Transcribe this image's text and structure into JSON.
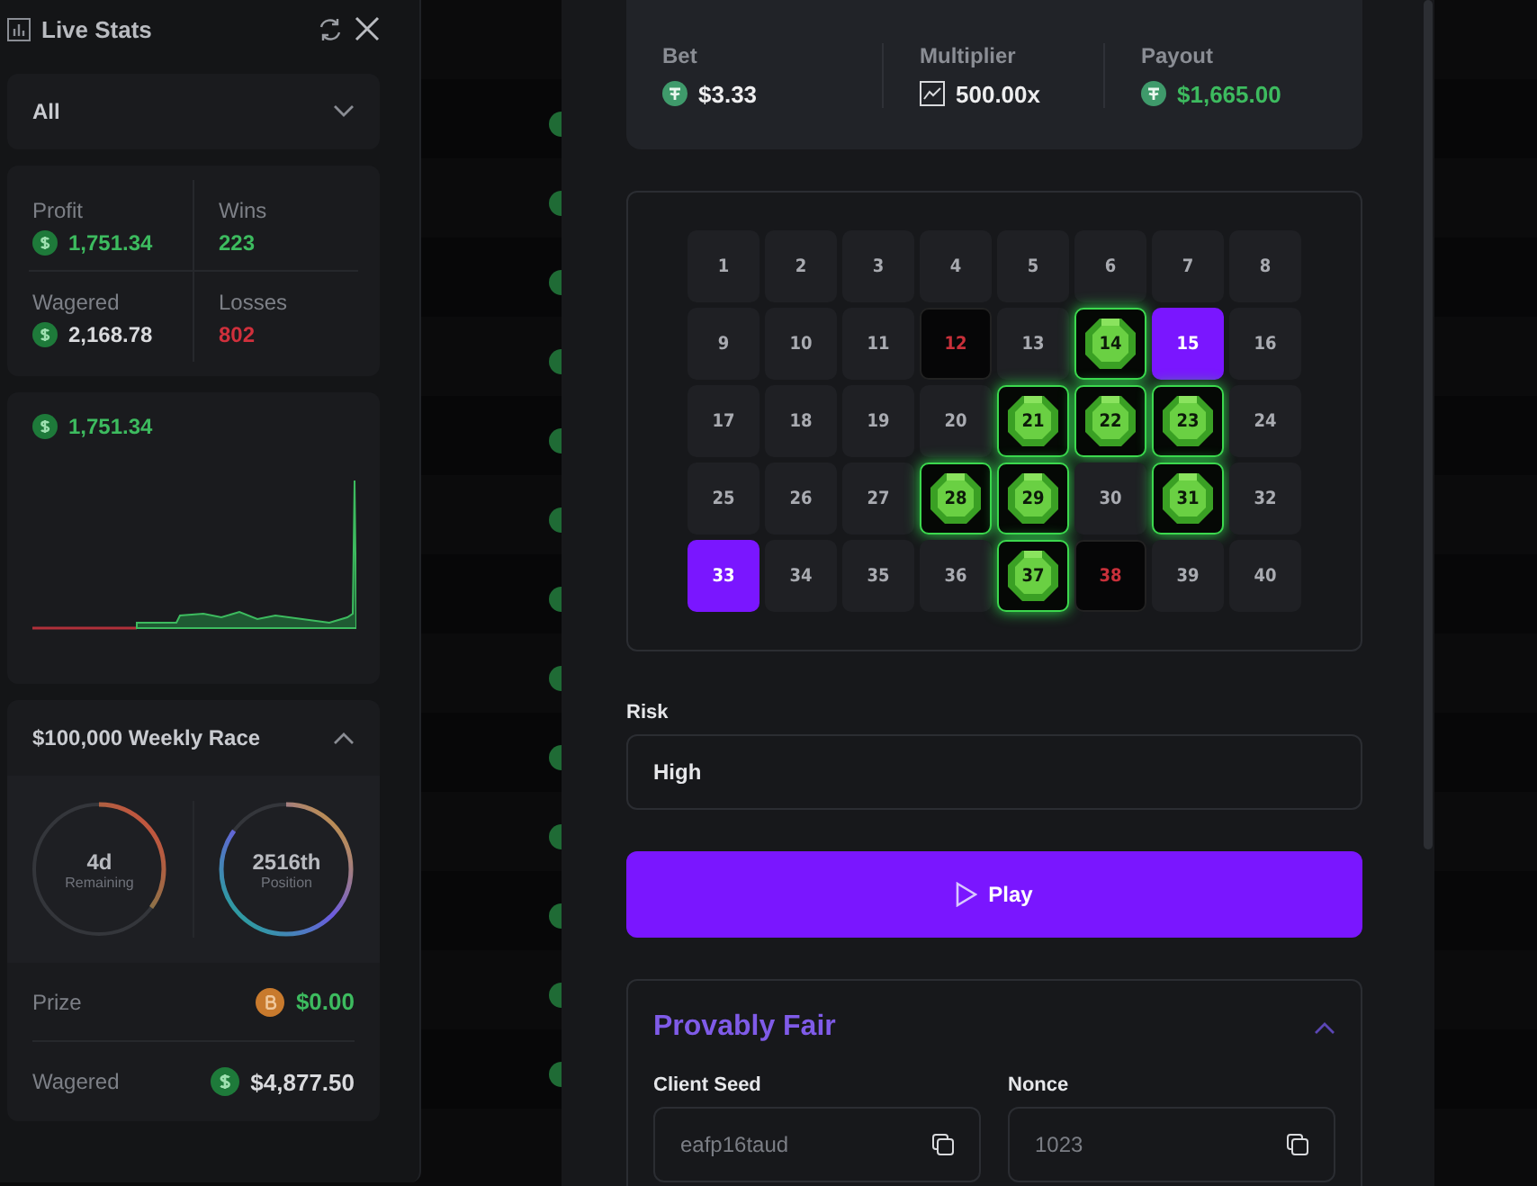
{
  "sidebar": {
    "title": "Live Stats",
    "filter": {
      "value": "All"
    },
    "stats": [
      {
        "label": "Profit",
        "value": "1,751.34",
        "color": "#3dbb5f",
        "kind": "coin"
      },
      {
        "label": "Wins",
        "value": "223",
        "color": "#3dbb5f",
        "kind": "plain"
      },
      {
        "label": "Wagered",
        "value": "2,168.78",
        "color": "#d9dadd",
        "kind": "coin"
      },
      {
        "label": "Losses",
        "value": "802",
        "color": "#d0303c",
        "kind": "plain"
      }
    ],
    "chart": {
      "value": "1,751.34"
    },
    "race": {
      "title": "$100,000 Weekly Race",
      "expanded": true,
      "rings": [
        {
          "value": "4d",
          "label": "Remaining",
          "level": 0.35
        },
        {
          "value": "2516th",
          "label": "Position",
          "level": 0.85
        }
      ],
      "rows": [
        {
          "label": "Prize",
          "kind": "bitcoin",
          "value": "$0.00",
          "color": "#3dbb5f"
        },
        {
          "label": "Wagered",
          "kind": "dollar",
          "value": "$4,877.50",
          "color": "#d9dadd"
        }
      ]
    }
  },
  "game": {
    "summary": [
      {
        "label": "Bet",
        "kind": "tether",
        "value": "$3.33",
        "color": "#eeeeef"
      },
      {
        "label": "Multiplier",
        "kind": "chart",
        "value": "500.00x",
        "color": "#eeeeef"
      },
      {
        "label": "Payout",
        "kind": "tether",
        "value": "$1,665.00",
        "color": "#3dbb5f"
      }
    ],
    "tiles": [
      {
        "number": "1",
        "kind": "plain"
      },
      {
        "number": "2",
        "kind": "plain"
      },
      {
        "number": "3",
        "kind": "plain"
      },
      {
        "number": "4",
        "kind": "plain"
      },
      {
        "number": "5",
        "kind": "plain"
      },
      {
        "number": "6",
        "kind": "plain"
      },
      {
        "number": "7",
        "kind": "plain"
      },
      {
        "number": "8",
        "kind": "plain"
      },
      {
        "number": "9",
        "kind": "plain"
      },
      {
        "number": "10",
        "kind": "plain"
      },
      {
        "number": "11",
        "kind": "plain"
      },
      {
        "number": "12",
        "kind": "miss"
      },
      {
        "number": "13",
        "kind": "plain"
      },
      {
        "number": "14",
        "kind": "gem"
      },
      {
        "number": "15",
        "kind": "selected"
      },
      {
        "number": "16",
        "kind": "plain"
      },
      {
        "number": "17",
        "kind": "plain"
      },
      {
        "number": "18",
        "kind": "plain"
      },
      {
        "number": "19",
        "kind": "plain"
      },
      {
        "number": "20",
        "kind": "plain"
      },
      {
        "number": "21",
        "kind": "gem"
      },
      {
        "number": "22",
        "kind": "gem"
      },
      {
        "number": "23",
        "kind": "gem"
      },
      {
        "number": "24",
        "kind": "plain"
      },
      {
        "number": "25",
        "kind": "plain"
      },
      {
        "number": "26",
        "kind": "plain"
      },
      {
        "number": "27",
        "kind": "plain"
      },
      {
        "number": "28",
        "kind": "gem"
      },
      {
        "number": "29",
        "kind": "gem"
      },
      {
        "number": "30",
        "kind": "plain"
      },
      {
        "number": "31",
        "kind": "gem"
      },
      {
        "number": "32",
        "kind": "plain"
      },
      {
        "number": "33",
        "kind": "selected"
      },
      {
        "number": "34",
        "kind": "plain"
      },
      {
        "number": "35",
        "kind": "plain"
      },
      {
        "number": "36",
        "kind": "plain"
      },
      {
        "number": "37",
        "kind": "gem"
      },
      {
        "number": "38",
        "kind": "miss"
      },
      {
        "number": "39",
        "kind": "plain"
      },
      {
        "number": "40",
        "kind": "plain"
      }
    ],
    "risk": {
      "label": "Risk",
      "value": "High"
    },
    "play_button": "Play",
    "provably_fair": {
      "title": "Provably Fair",
      "expanded": true,
      "fields": [
        {
          "label": "Client Seed",
          "value": "eafp16taud"
        },
        {
          "label": "Nonce",
          "value": "1023"
        }
      ]
    }
  }
}
